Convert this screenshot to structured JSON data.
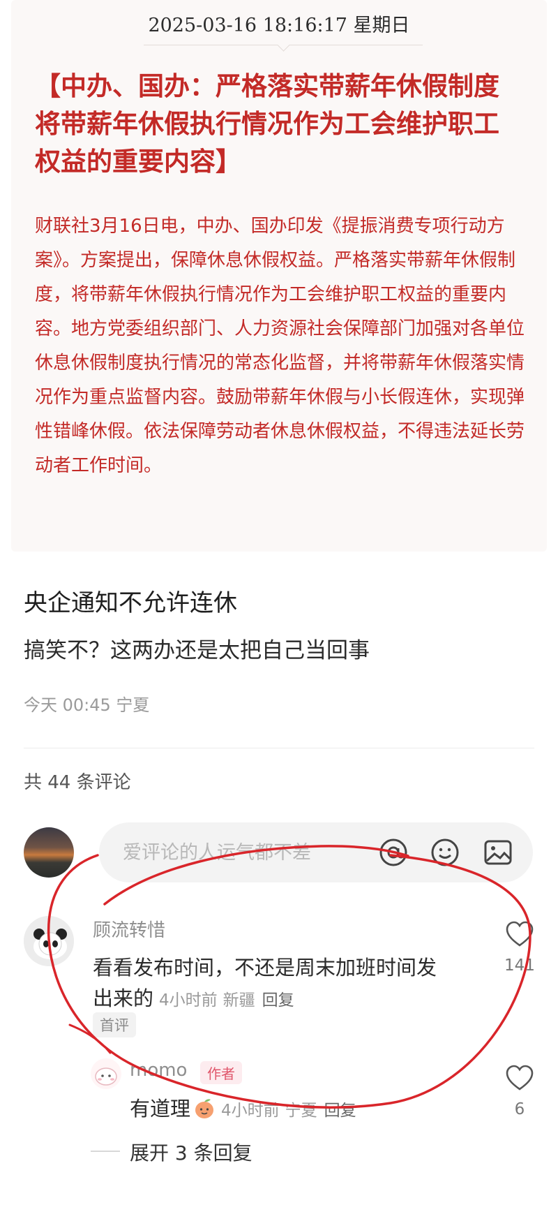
{
  "news": {
    "timestamp": "2025-03-16 18:16:17 星期日",
    "title": "【中办、国办：严格落实带薪年休假制度 将带薪年休假执行情况作为工会维护职工权益的重要内容】",
    "body": "财联社3月16日电，中办、国办印发《提振消费专项行动方案》。方案提出，保障休息休假权益。严格落实带薪年休假制度，将带薪年休假执行情况作为工会维护职工权益的重要内容。地方党委组织部门、人力资源社会保障部门加强对各单位休息休假制度执行情况的常态化监督，并将带薪年休假落实情况作为重点监督内容。鼓励带薪年休假与小长假连休，实现弹性错峰休假。依法保障劳动者休息休假权益，不得违法延长劳动者工作时间。"
  },
  "post": {
    "title": "央企通知不允许连休",
    "body": "搞笑不？这两办还是太把自己当回事",
    "meta": "今天 00:45 宁夏"
  },
  "comments_header": {
    "count_label": "共 44 条评论"
  },
  "comment_input": {
    "placeholder": "爱评论的人运气都不差",
    "icons": [
      "at-icon",
      "emoji-icon",
      "image-icon"
    ]
  },
  "comments": [
    {
      "author": "顾流转惜",
      "text_line1": "看看发布时间，不还是周末加班时间发",
      "text_line2": "出来的",
      "time": "4小时前",
      "location": "新疆",
      "reply_label": "回复",
      "badge": "首评",
      "likes": "141"
    }
  ],
  "reply": {
    "author": "momo",
    "author_badge": "作者",
    "text": "有道理",
    "time": "4小时前",
    "location": "宁夏",
    "reply_label": "回复",
    "likes": "6"
  },
  "expand_label": "展开 3 条回复",
  "colors": {
    "headline_red": "#c32a27",
    "annotation_red": "#d9252a"
  }
}
